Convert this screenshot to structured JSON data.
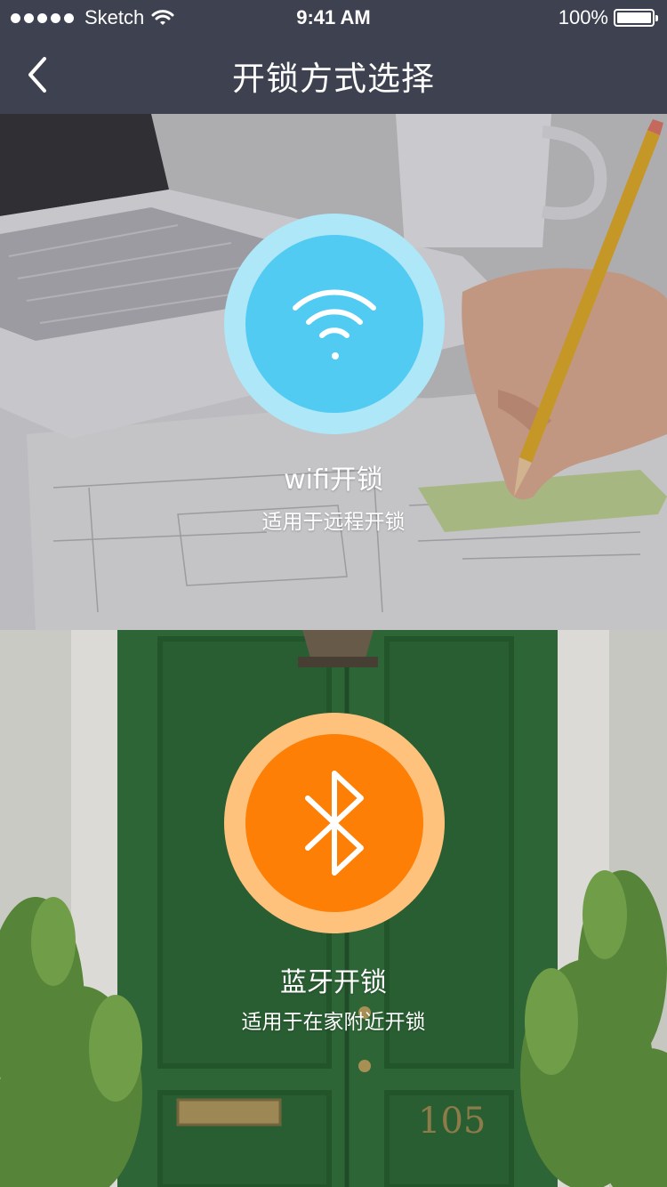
{
  "status_bar": {
    "carrier": "Sketch",
    "time": "9:41 AM",
    "battery": "100%",
    "battery_level": 1.0
  },
  "header": {
    "title": "开锁方式选择",
    "back_icon": "chevron-left-icon"
  },
  "options": [
    {
      "title": "wifi开锁",
      "subtitle": "适用于远程开锁",
      "icon": "wifi-icon",
      "ring_color": "#ade7f8",
      "circle_color": "#52cbf2"
    },
    {
      "title": "蓝牙开锁",
      "subtitle": "适用于在家附近开锁",
      "icon": "bluetooth-icon",
      "ring_color": "#ffc27d",
      "circle_color": "#fe7f06"
    }
  ],
  "colors": {
    "header_bg": "#3e4150",
    "text": "#ffffff"
  }
}
